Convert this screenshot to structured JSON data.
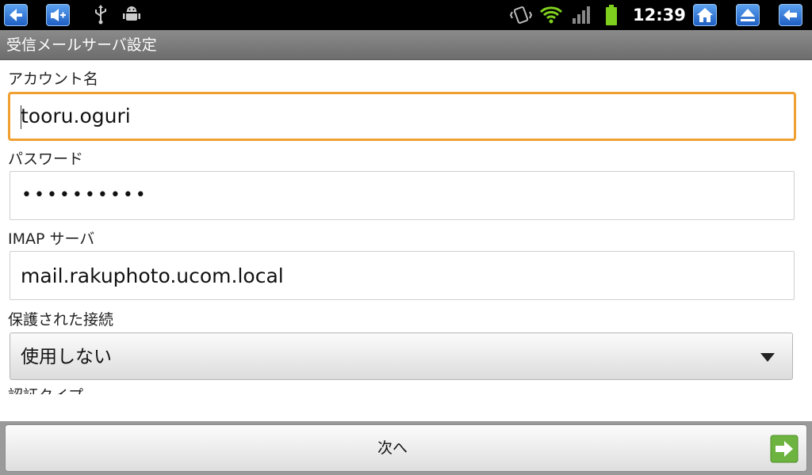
{
  "status_bar": {
    "time": "12:39",
    "left_icons": [
      "back-nav-icon",
      "volume-up-icon",
      "usb-icon",
      "android-debug-icon"
    ],
    "right_icons": [
      "vibrate-icon",
      "wifi-icon",
      "signal-icon",
      "battery-icon"
    ],
    "nav_buttons": [
      "home-icon",
      "eject-icon",
      "back-arrow-icon"
    ]
  },
  "title_bar": {
    "title": "受信メールサーバ設定"
  },
  "form": {
    "account_label": "アカウント名",
    "account_value": "tooru.oguri",
    "password_label": "パスワード",
    "password_value": "••••••••••",
    "imap_label": "IMAP サーバ",
    "imap_value": "mail.rakuphoto.ucom.local",
    "security_label": "保護された接続",
    "security_value": "使用しない",
    "auth_type_label": "認証タイプ"
  },
  "footer": {
    "next_label": "次へ"
  },
  "colors": {
    "focus_border": "#f0a030",
    "title_bar": "#7b7b7b",
    "status_bar": "#000000",
    "next_arrow": "#6db33f"
  }
}
